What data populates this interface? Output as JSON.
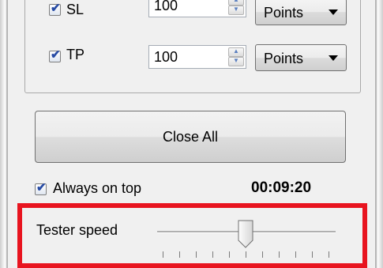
{
  "rows": [
    {
      "label": "SL",
      "checked": true,
      "value": "100",
      "unit": "Points"
    },
    {
      "label": "TP",
      "checked": true,
      "value": "100",
      "unit": "Points"
    }
  ],
  "close_all_label": "Close All",
  "always_on_top": {
    "label": "Always on top",
    "checked": true
  },
  "timer": "00:09:20",
  "tester_speed": {
    "label": "Tester speed",
    "value_fraction": 0.5,
    "tick_count": 11
  },
  "colors": {
    "highlight": "#e8141f",
    "check": "#264aa4"
  },
  "icons": {
    "check": "checkmark-icon",
    "spin_up": "spin-up-icon",
    "spin_down": "spin-down-icon",
    "dropdown": "dropdown-arrow-icon"
  }
}
